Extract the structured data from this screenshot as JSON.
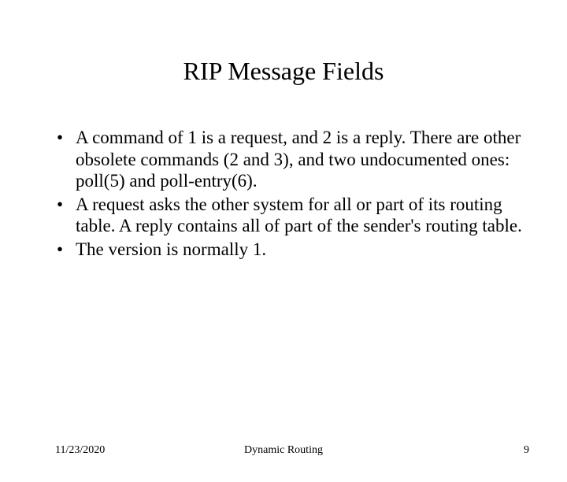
{
  "title": "RIP Message Fields",
  "bullets": [
    "A command of 1 is a request, and 2 is a reply. There are other obsolete commands (2 and 3), and two undocumented ones: poll(5) and poll-entry(6).",
    "A request asks the other system for all or part of its routing table. A reply contains all of part of the sender's routing table.",
    "The version is normally 1."
  ],
  "footer": {
    "date": "11/23/2020",
    "center": "Dynamic Routing",
    "page": "9"
  }
}
